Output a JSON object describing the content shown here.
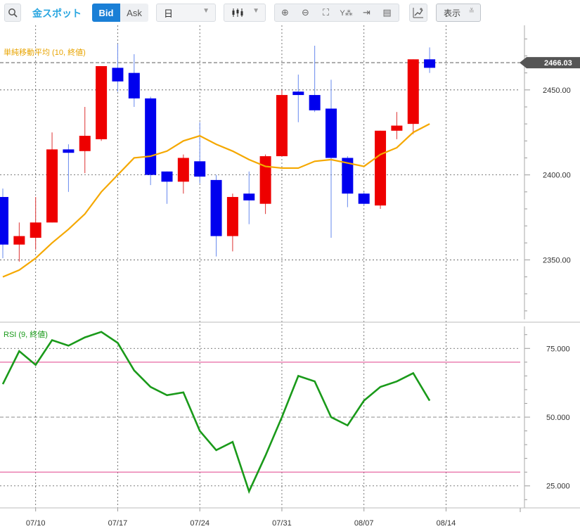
{
  "toolbar": {
    "symbol": "金スポット",
    "bid_label": "Bid",
    "ask_label": "Ask",
    "period": "日",
    "display_label": "表示",
    "icons": [
      "search-icon",
      "candlestick-icon",
      "zoom-in-icon",
      "zoom-out-icon",
      "fit-icon",
      "price-scale-icon",
      "jump-to-latest-icon",
      "notes-icon",
      "drawing-icon",
      "chevron-down-icon"
    ]
  },
  "chart_data": [
    {
      "type": "candlestick",
      "title": "単純移動平均 (10, 終値)",
      "x_tick_labels": [
        "07/10",
        "07/17",
        "07/24",
        "07/31",
        "08/07",
        "08/14"
      ],
      "y_tick_labels": [
        "2350.00",
        "2400.00",
        "2450.00"
      ],
      "ylim": [
        2315,
        2488
      ],
      "current_price": "2466.03",
      "colors": {
        "up": "#ee0000",
        "down": "#0000ee",
        "sma": "#f5a800",
        "price_tag": "#555555"
      },
      "candles": [
        {
          "o": 2387,
          "h": 2392,
          "l": 2351,
          "c": 2359
        },
        {
          "o": 2359,
          "h": 2372,
          "l": 2349,
          "c": 2364
        },
        {
          "o": 2363,
          "h": 2387,
          "l": 2356,
          "c": 2372
        },
        {
          "o": 2372,
          "h": 2425,
          "l": 2372,
          "c": 2415
        },
        {
          "o": 2415,
          "h": 2418,
          "l": 2390,
          "c": 2413
        },
        {
          "o": 2414,
          "h": 2440,
          "l": 2401,
          "c": 2423
        },
        {
          "o": 2421,
          "h": 2464,
          "l": 2420,
          "c": 2464
        },
        {
          "o": 2463,
          "h": 2477,
          "l": 2449,
          "c": 2455
        },
        {
          "o": 2460,
          "h": 2471,
          "l": 2440,
          "c": 2445
        },
        {
          "o": 2445,
          "h": 2446,
          "l": 2394,
          "c": 2400
        },
        {
          "o": 2402,
          "h": 2402,
          "l": 2383,
          "c": 2396
        },
        {
          "o": 2396,
          "h": 2412,
          "l": 2389,
          "c": 2410
        },
        {
          "o": 2408,
          "h": 2431,
          "l": 2395,
          "c": 2399
        },
        {
          "o": 2397,
          "h": 2400,
          "l": 2352,
          "c": 2364
        },
        {
          "o": 2364,
          "h": 2389,
          "l": 2355,
          "c": 2387
        },
        {
          "o": 2389,
          "h": 2402,
          "l": 2371,
          "c": 2385
        },
        {
          "o": 2383,
          "h": 2412,
          "l": 2377,
          "c": 2411
        },
        {
          "o": 2411,
          "h": 2450,
          "l": 2411,
          "c": 2447
        },
        {
          "o": 2449,
          "h": 2459,
          "l": 2431,
          "c": 2447
        },
        {
          "o": 2447,
          "h": 2476,
          "l": 2437,
          "c": 2438
        },
        {
          "o": 2439,
          "h": 2456,
          "l": 2363,
          "c": 2410
        },
        {
          "o": 2410,
          "h": 2411,
          "l": 2381,
          "c": 2389
        },
        {
          "o": 2389,
          "h": 2390,
          "l": 2382,
          "c": 2383
        },
        {
          "o": 2382,
          "h": 2426,
          "l": 2380,
          "c": 2426
        },
        {
          "o": 2426,
          "h": 2437,
          "l": 2421,
          "c": 2429
        },
        {
          "o": 2430,
          "h": 2468,
          "l": 2424,
          "c": 2468
        },
        {
          "o": 2468,
          "h": 2475,
          "l": 2460,
          "c": 2463
        }
      ],
      "sma": [
        2340,
        2344,
        2351,
        2360,
        2368,
        2377,
        2390,
        2400,
        2410,
        2411,
        2414,
        2420,
        2423,
        2418,
        2414,
        2409,
        2405,
        2404,
        2404,
        2408,
        2409,
        2407,
        2405,
        2412,
        2416,
        2425,
        2430
      ]
    },
    {
      "type": "line",
      "title": "RSI (9, 終値)",
      "y_tick_labels": [
        "25.000",
        "50.000",
        "75.000"
      ],
      "ylim": [
        17,
        83
      ],
      "reference_lines": [
        30,
        70
      ],
      "colors": {
        "line": "#1a9a1a",
        "reference": "#e0408a"
      },
      "values": [
        62,
        74,
        69,
        78,
        76,
        79,
        81,
        77,
        67,
        61,
        58,
        59,
        45,
        38,
        41,
        23,
        36,
        50,
        65,
        63,
        50,
        47,
        56,
        61,
        63,
        66,
        56
      ]
    }
  ]
}
